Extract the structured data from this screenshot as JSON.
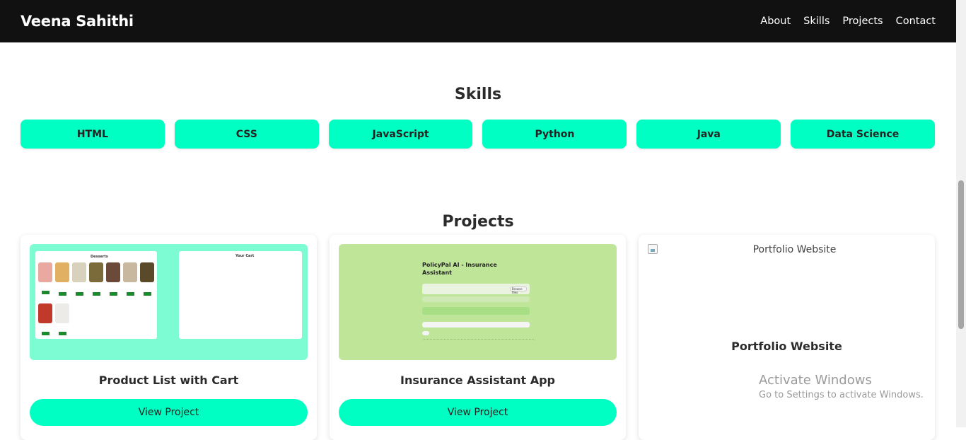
{
  "header": {
    "brand": "Veena Sahithi",
    "nav": [
      "About",
      "Skills",
      "Projects",
      "Contact"
    ]
  },
  "skills": {
    "title": "Skills",
    "items": [
      "HTML",
      "CSS",
      "JavaScript",
      "Python",
      "Java",
      "Data Science"
    ]
  },
  "projects": {
    "title": "Projects",
    "cards": [
      {
        "title": "Product List with Cart",
        "button": "View Project",
        "thumb": {
          "list_heading": "Desserts",
          "cart_heading": "Your Cart"
        }
      },
      {
        "title": "Insurance Assistant App",
        "button": "View Project",
        "thumb": {
          "heading": "PolicyPal AI - Insurance Assistant",
          "browse": "Browse files"
        }
      },
      {
        "title": "Portfolio Website",
        "image_alt": "Portfolio Website"
      }
    ]
  },
  "watermark": {
    "line1": "Activate Windows",
    "line2": "Go to Settings to activate Windows."
  },
  "colors": {
    "accent": "#00ffc3",
    "navbar": "#111111"
  }
}
